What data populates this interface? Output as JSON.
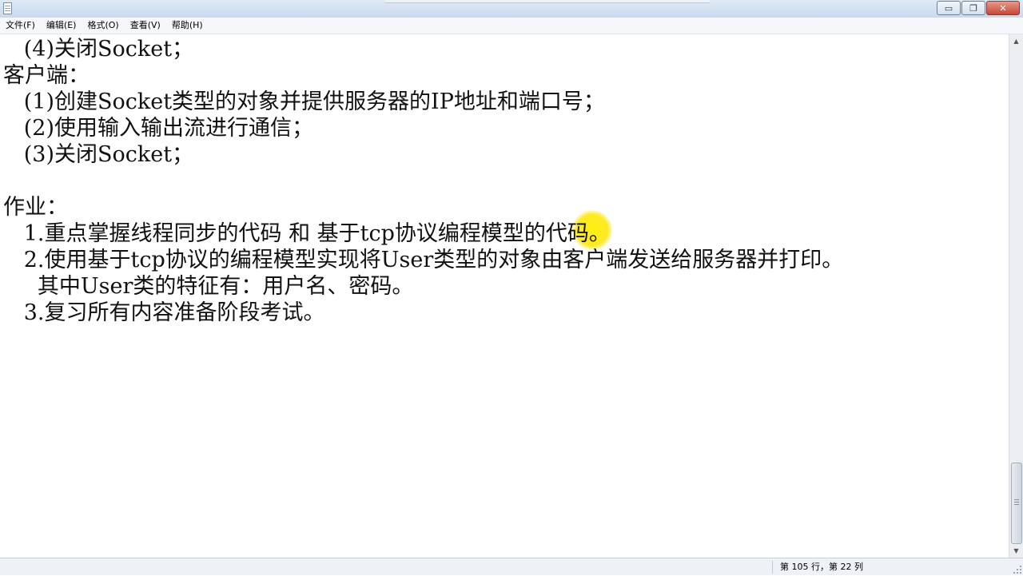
{
  "menubar": {
    "items": [
      "文件(F)",
      "编辑(E)",
      "格式(O)",
      "查看(V)",
      "帮助(H)"
    ]
  },
  "window_controls": {
    "minimize": "▭",
    "restore": "❐",
    "close": "✕"
  },
  "document": {
    "lines": [
      "   (4)关闭Socket；",
      "客户端：",
      "   (1)创建Socket类型的对象并提供服务器的IP地址和端口号；",
      "   (2)使用输入输出流进行通信；",
      "   (3)关闭Socket；",
      "",
      "作业：",
      "   1.重点掌握线程同步的代码 和 基于tcp协议编程模型的代码。",
      "   2.使用基于tcp协议的编程模型实现将User类型的对象由客户端发送给服务器并打印。",
      "     其中User类的特征有：用户名、密码。",
      "   3.复习所有内容准备阶段考试。"
    ]
  },
  "status": {
    "position": "第 105 行，第 22 列"
  }
}
